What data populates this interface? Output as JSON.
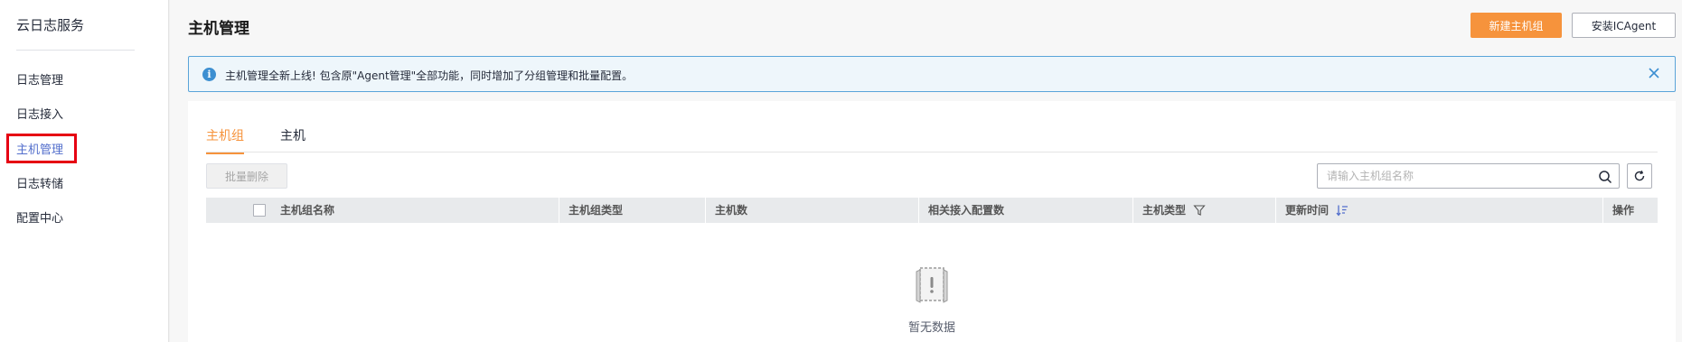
{
  "sidebar": {
    "title": "云日志服务",
    "items": [
      {
        "label": "日志管理"
      },
      {
        "label": "日志接入"
      },
      {
        "label": "主机管理"
      },
      {
        "label": "日志转储"
      },
      {
        "label": "配置中心"
      }
    ],
    "active_index": 2
  },
  "header": {
    "title": "主机管理",
    "primary_button": "新建主机组",
    "secondary_button": "安装ICAgent"
  },
  "notice": {
    "icon": "info-icon",
    "text": "主机管理全新上线! 包含原\"Agent管理\"全部功能，同时增加了分组管理和批量配置。"
  },
  "tabs": [
    {
      "label": "主机组",
      "active": true
    },
    {
      "label": "主机",
      "active": false
    }
  ],
  "toolbar": {
    "batch_delete": "批量删除",
    "search_placeholder": "请输入主机组名称"
  },
  "table": {
    "columns": [
      "主机组名称",
      "主机组类型",
      "主机数",
      "相关接入配置数",
      "主机类型",
      "更新时间",
      "操作"
    ],
    "rows": []
  },
  "empty_state": {
    "text": "暂无数据"
  },
  "colors": {
    "accent": "#f6933c",
    "link": "#526ecc",
    "info": "#3d8fd1",
    "highlight": "#e60012"
  }
}
